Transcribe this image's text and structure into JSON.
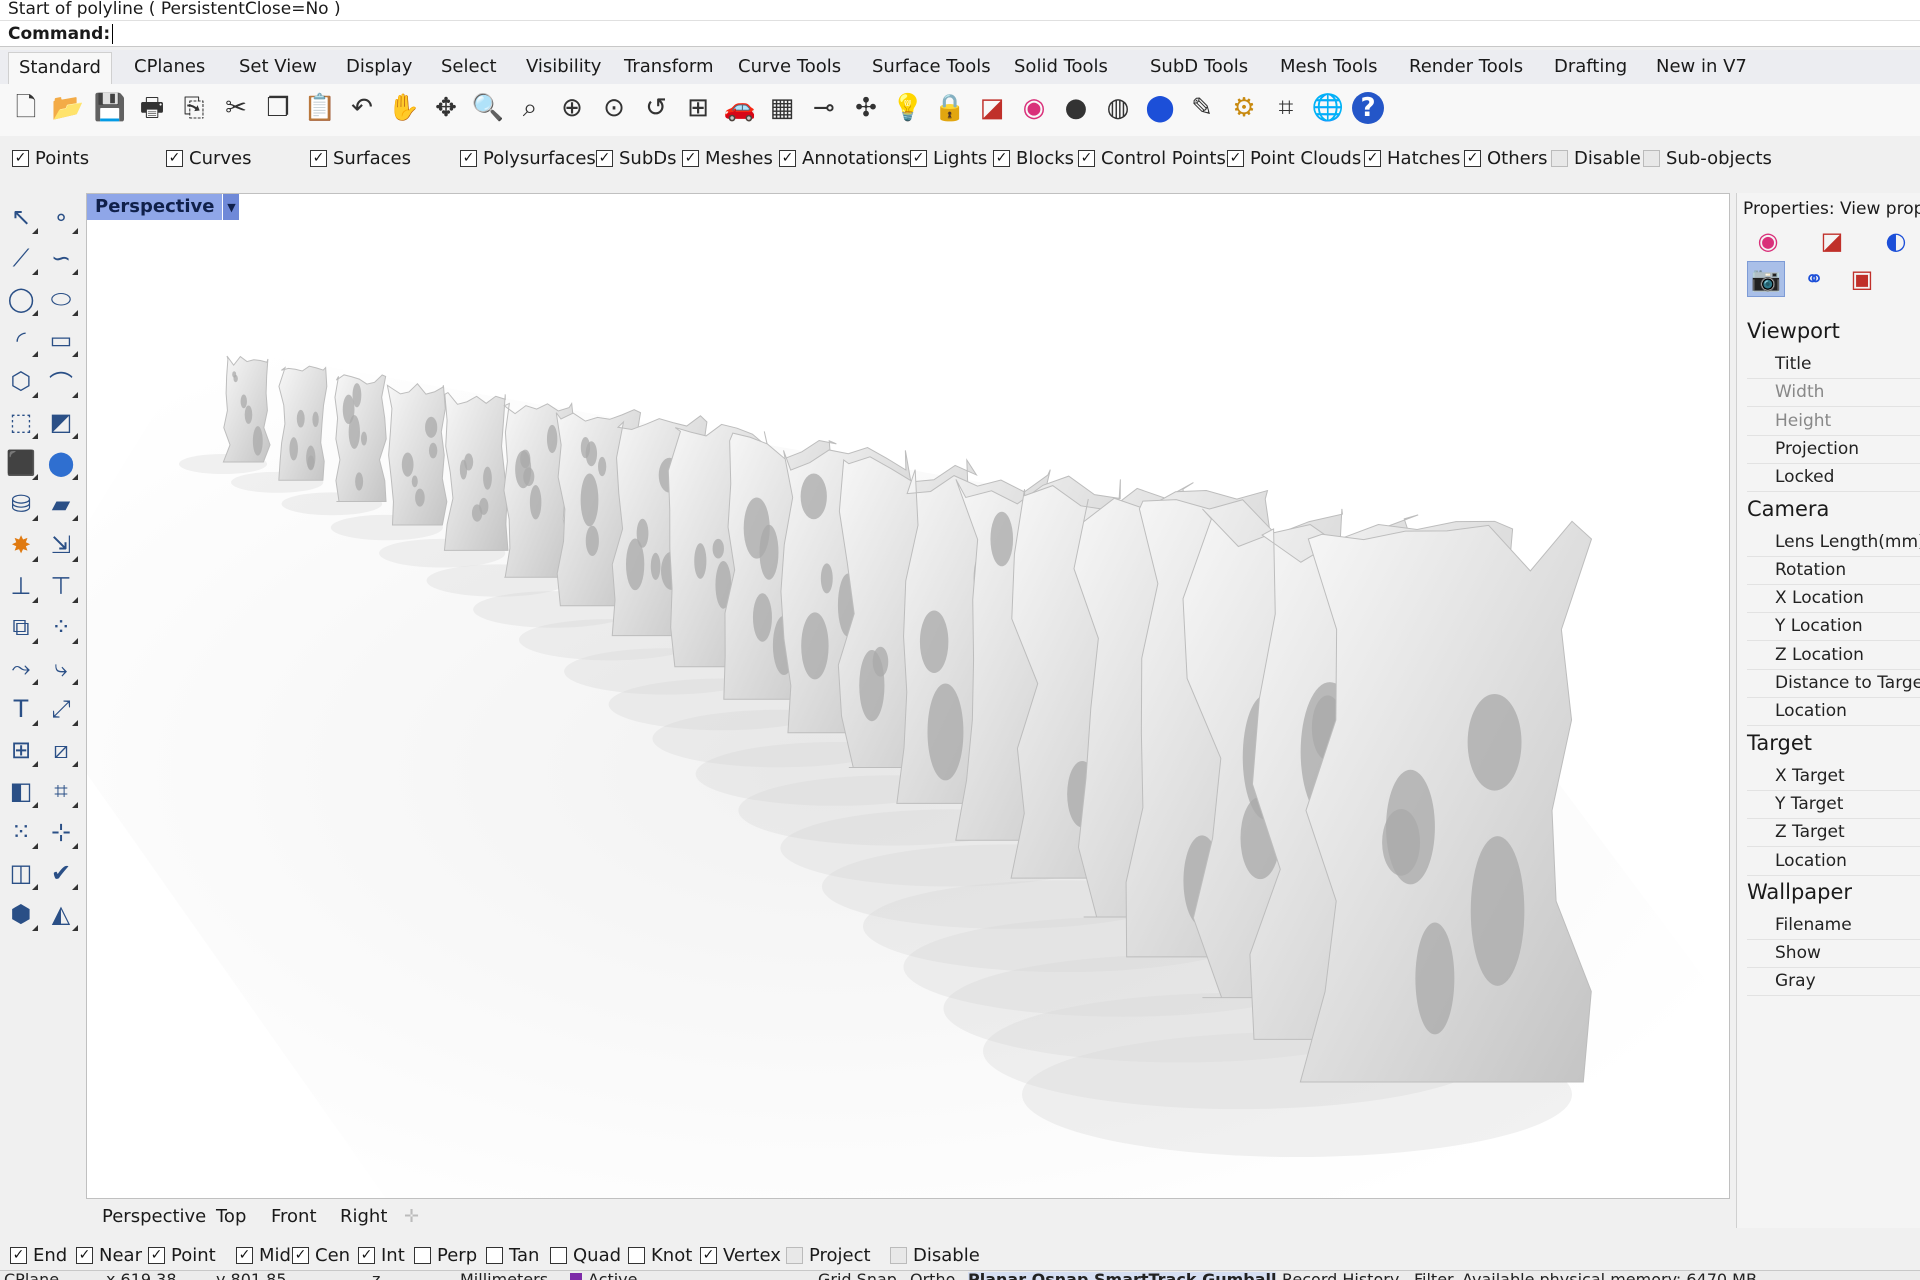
{
  "command": {
    "history": "Start of polyline ( PersistentClose=No )",
    "prompt": "Command:"
  },
  "tabs": [
    "Standard",
    "CPlanes",
    "Set View",
    "Display",
    "Select",
    "Visibility",
    "Transform",
    "Curve Tools",
    "Surface Tools",
    "Solid Tools",
    "SubD Tools",
    "Mesh Tools",
    "Render Tools",
    "Drafting",
    "New in V7"
  ],
  "active_tab": "Standard",
  "toolbar_icons": [
    "new-file-icon",
    "open-folder-icon",
    "save-icon",
    "print-icon",
    "export-icon",
    "cut-icon",
    "copy-icon",
    "paste-icon",
    "undo-icon",
    "pan-hand-icon",
    "rotate-view-icon",
    "zoom-icon",
    "zoom-window-icon",
    "zoom-extents-icon",
    "zoom-selected-icon",
    "undo-view-icon",
    "four-viewports-icon",
    "car-icon",
    "grid-icon",
    "cplane-icon",
    "move-icon",
    "light-bulb-icon",
    "lock-icon",
    "layer-icon",
    "color-wheel-icon",
    "shaded-sphere-icon",
    "wireframe-sphere-icon",
    "render-sphere-icon",
    "options-icon",
    "gear-icon",
    "dimension-icon",
    "globe-icon",
    "help-icon"
  ],
  "filter": {
    "items": [
      {
        "label": "Points",
        "checked": true
      },
      {
        "label": "Curves",
        "checked": true
      },
      {
        "label": "Surfaces",
        "checked": true
      },
      {
        "label": "Polysurfaces",
        "checked": true
      },
      {
        "label": "SubDs",
        "checked": true
      },
      {
        "label": "Meshes",
        "checked": true
      },
      {
        "label": "Annotations",
        "checked": true
      },
      {
        "label": "Lights",
        "checked": true
      },
      {
        "label": "Blocks",
        "checked": true
      },
      {
        "label": "Control Points",
        "checked": true
      },
      {
        "label": "Point Clouds",
        "checked": true
      },
      {
        "label": "Hatches",
        "checked": true
      },
      {
        "label": "Others",
        "checked": true
      },
      {
        "label": "Disable",
        "checked": false
      },
      {
        "label": "Sub-objects",
        "checked": false
      }
    ]
  },
  "left_toolbar_icons": [
    "select-arrow-icon",
    "point-icon",
    "polyline-icon",
    "curve-icon",
    "circle-icon",
    "ellipse-icon",
    "arc-icon",
    "rectangle-icon",
    "polygon-icon",
    "fillet-curve-icon",
    "surface-points-icon",
    "surface-edge-icon",
    "box-icon",
    "sphere-icon",
    "cylinder-icon",
    "plane-surface-icon",
    "explode-icon",
    "extend-icon",
    "split-icon",
    "trim-icon",
    "boolean-icon",
    "group-icon",
    "offset-icon",
    "blend-icon",
    "text-icon",
    "scale-icon",
    "array-icon",
    "transform-icon",
    "solid-edit-icon",
    "dimension-icon",
    "grid-array-icon",
    "gumball-icon",
    "analyze-icon",
    "check-icon",
    "cube-view-icon",
    "render-icon"
  ],
  "viewport": {
    "title": "Perspective",
    "tabs": [
      "Perspective",
      "Top",
      "Front",
      "Right"
    ]
  },
  "properties": {
    "title": "Properties: View properties",
    "tab_icons": [
      "color-wheel-icon",
      "layer-icon",
      "render-material-icon"
    ],
    "sub_icons": [
      "camera-icon",
      "molecule-icon",
      "frame-icon"
    ],
    "sections": [
      {
        "title": "Viewport",
        "fields": [
          {
            "label": "Title",
            "dim": false
          },
          {
            "label": "Width",
            "dim": true
          },
          {
            "label": "Height",
            "dim": true
          },
          {
            "label": "Projection",
            "dim": false
          },
          {
            "label": "Locked",
            "dim": false
          }
        ]
      },
      {
        "title": "Camera",
        "fields": [
          {
            "label": "Lens Length(mm)",
            "dim": false
          },
          {
            "label": "Rotation",
            "dim": false
          },
          {
            "label": "X Location",
            "dim": false
          },
          {
            "label": "Y Location",
            "dim": false
          },
          {
            "label": "Z Location",
            "dim": false
          },
          {
            "label": "Distance to Target",
            "dim": false
          },
          {
            "label": "Location",
            "dim": false
          }
        ]
      },
      {
        "title": "Target",
        "fields": [
          {
            "label": "X Target",
            "dim": false
          },
          {
            "label": "Y Target",
            "dim": false
          },
          {
            "label": "Z Target",
            "dim": false
          },
          {
            "label": "Location",
            "dim": false
          }
        ]
      },
      {
        "title": "Wallpaper",
        "fields": [
          {
            "label": "Filename",
            "dim": false
          },
          {
            "label": "Show",
            "dim": false
          },
          {
            "label": "Gray",
            "dim": false
          }
        ]
      }
    ]
  },
  "osnap": {
    "items": [
      {
        "label": "End",
        "checked": true
      },
      {
        "label": "Near",
        "checked": true
      },
      {
        "label": "Point",
        "checked": true
      },
      {
        "label": "Mid",
        "checked": true
      },
      {
        "label": "Cen",
        "checked": true
      },
      {
        "label": "Int",
        "checked": true
      },
      {
        "label": "Perp",
        "checked": false
      },
      {
        "label": "Tan",
        "checked": false
      },
      {
        "label": "Quad",
        "checked": false
      },
      {
        "label": "Knot",
        "checked": false
      },
      {
        "label": "Vertex",
        "checked": true
      },
      {
        "label": "Project",
        "checked": false
      },
      {
        "label": "Disable",
        "checked": false
      }
    ]
  },
  "status": {
    "cplane": "CPlane",
    "x": "x 619.38",
    "y": "y 801.85",
    "z": "z",
    "units": "Millimeters",
    "layer": "Active",
    "grid_snap": "Grid Snap",
    "ortho": "Ortho",
    "modes": "Planar  Osnap  SmartTrack  Gumball",
    "record_history": "Record History",
    "filter": "Filter",
    "memory": "Available physical memory: 6470 MB"
  },
  "colors": {
    "viewport_title_bg": "#8fa6e8",
    "selected_icon_bg": "#a9bfe8",
    "layer_swatch": "#7d2aa8"
  }
}
